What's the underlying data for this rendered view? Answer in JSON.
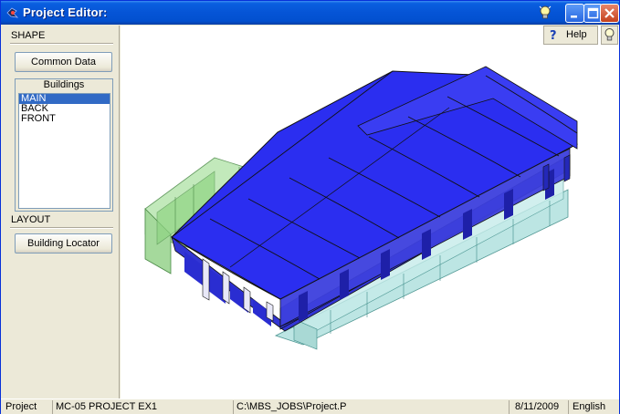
{
  "window": {
    "title": "Project Editor:"
  },
  "left_panel": {
    "shape_label": "SHAPE",
    "common_data_button": "Common Data",
    "buildings_group_title": "Buildings",
    "buildings": [
      "MAIN",
      "BACK",
      "FRONT"
    ],
    "selected_building": "MAIN",
    "layout_label": "LAYOUT",
    "building_locator_button": "Building Locator"
  },
  "toolbar": {
    "help_label": "Help"
  },
  "status_bar": {
    "mode": "Project",
    "project_name": "MC-05 PROJECT EX1",
    "path": "C:\\MBS_JOBS\\Project.P",
    "date": "8/11/2009",
    "language": "English"
  },
  "colors": {
    "roof": "#2b2ef0",
    "glass_green": "#b8e6b0",
    "glass_cyan": "#b5e3e0",
    "title_bar": "#0554d6",
    "selection": "#316ac5"
  },
  "icons": {
    "app_icon": "app-logo-icon",
    "titlebar_tip": "lightbulb-icon",
    "help": "question-mark-icon",
    "tip": "lightbulb-icon"
  }
}
